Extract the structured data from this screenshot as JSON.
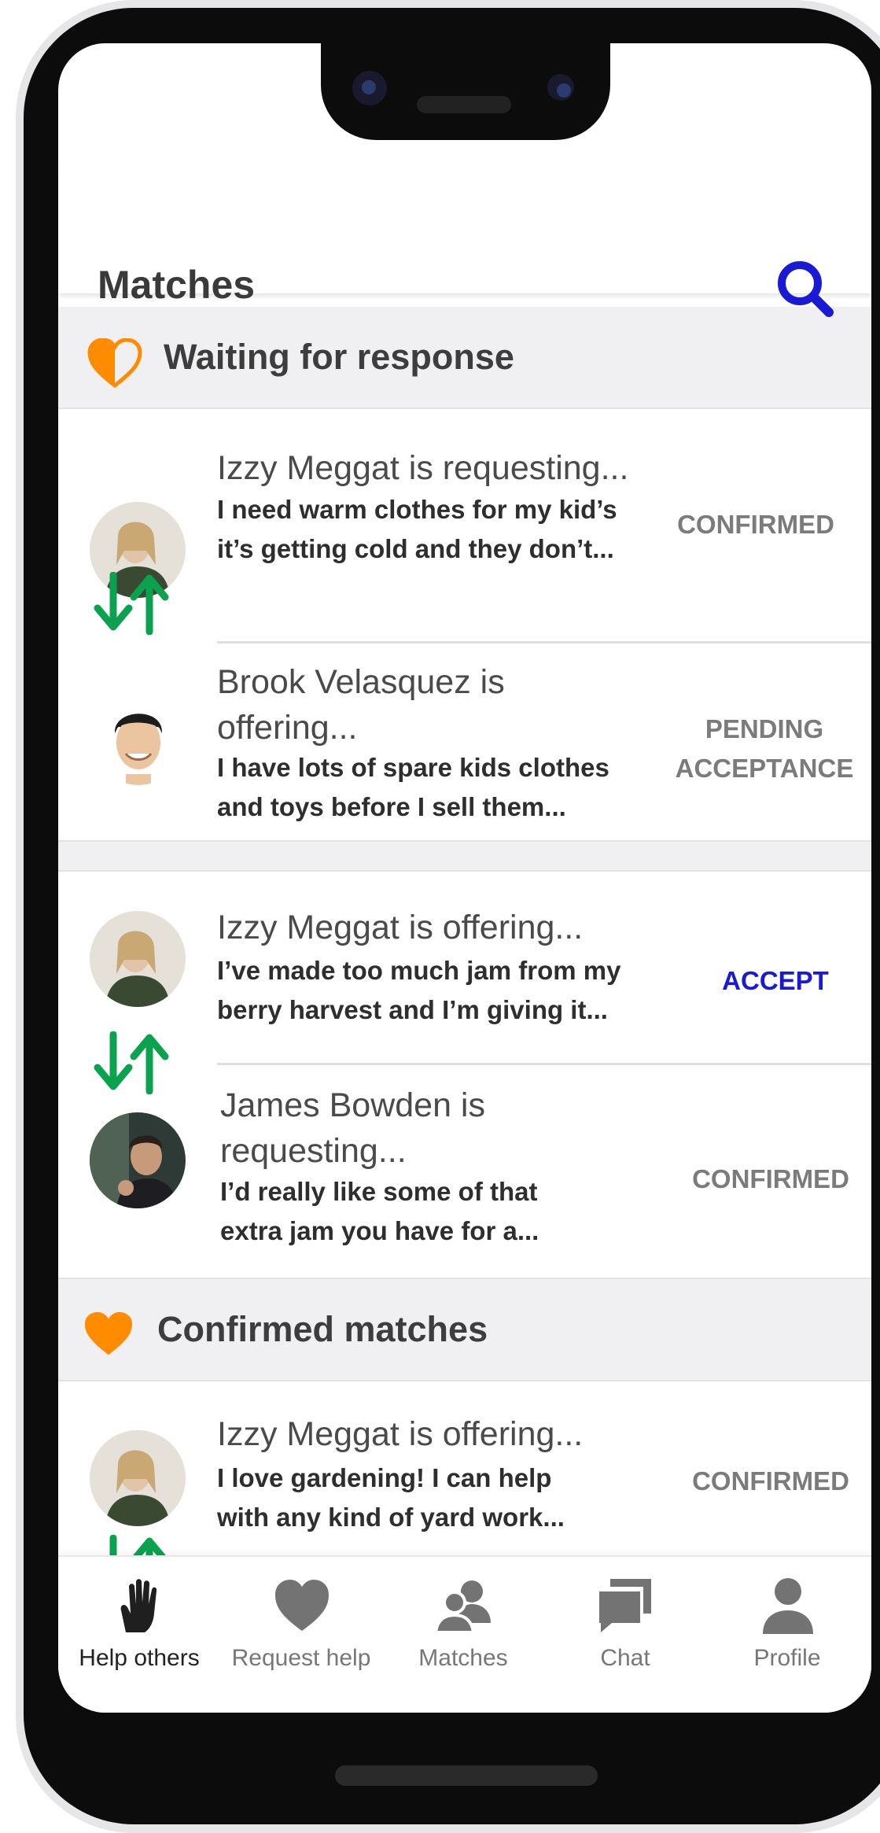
{
  "header": {
    "title": "Matches"
  },
  "sections": {
    "waiting": {
      "title": "Waiting for response"
    },
    "confirmed": {
      "title": "Confirmed matches"
    }
  },
  "match_groups": [
    {
      "rows": [
        {
          "name": "Izzy Meggat is requesting...",
          "desc_line1": "I need warm clothes for my kid’s",
          "desc_line2": "it’s getting cold and they don’t...",
          "status": "CONFIRMED"
        },
        {
          "name_line1": "Brook Velasquez is",
          "name_line2": "offering...",
          "desc_line1": "I have lots of spare kids clothes",
          "desc_line2": "and toys before I sell them...",
          "status_line1": "PENDING",
          "status_line2": "ACCEPTANCE"
        }
      ]
    },
    {
      "rows": [
        {
          "name": "Izzy Meggat is offering...",
          "desc_line1": "I’ve made too much jam from my",
          "desc_line2": "berry harvest and I’m giving it...",
          "status": "ACCEPT"
        },
        {
          "name_line1": "James Bowden is",
          "name_line2": "requesting...",
          "desc_line1": "I’d really like some of that",
          "desc_line2": "extra jam you have for a...",
          "status": "CONFIRMED"
        }
      ]
    },
    {
      "rows": [
        {
          "name": "Izzy Meggat is offering...",
          "desc_line1": "I love gardening! I can help",
          "desc_line2": "with any kind of yard work...",
          "status": "CONFIRMED"
        }
      ]
    }
  ],
  "bottom_nav": [
    {
      "label": "Help others",
      "icon": "hand-icon",
      "active": true
    },
    {
      "label": "Request help",
      "icon": "heart-icon"
    },
    {
      "label": "Matches",
      "icon": "people-icon"
    },
    {
      "label": "Chat",
      "icon": "chat-icon"
    },
    {
      "label": "Profile",
      "icon": "person-icon"
    }
  ],
  "colors": {
    "accent": "#1a1ad6",
    "heart": "#ff8c00",
    "swap_arrows": "#0aa14f"
  }
}
